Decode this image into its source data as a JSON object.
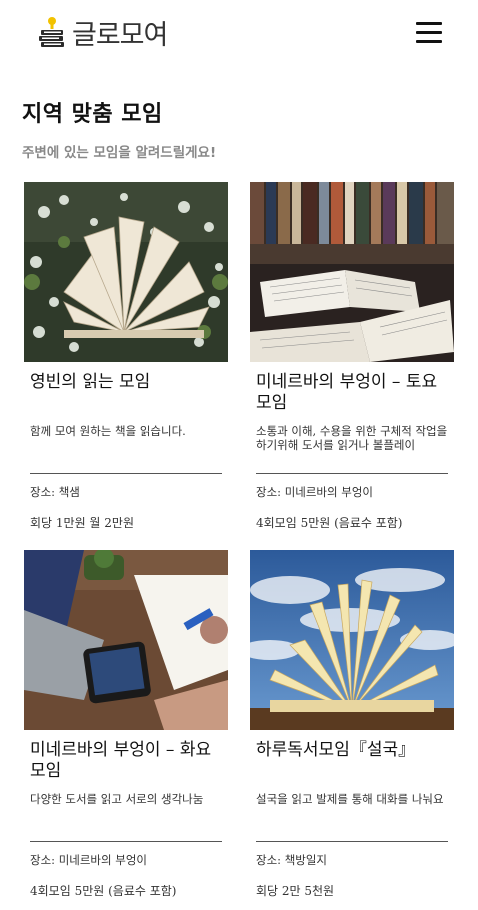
{
  "header": {
    "logo_text": "글로모여",
    "logo_icon": "books-with-lightbulb-icon",
    "menu_icon": "hamburger-menu-icon"
  },
  "page": {
    "title": "지역 맞춤 모임",
    "subtitle": "주변에 있는 모임을 알려드릴게요!"
  },
  "cards": [
    {
      "name": "영빈의 읽는 모임",
      "desc": "함께 모여 원하는 책을 읽습니다.",
      "place": "장소: 책샘",
      "fee": "회당 1만원 월 2만원"
    },
    {
      "name": "미네르바의 부엉이 – 토요모임",
      "desc": "소통과 이해, 수용을 위한 구체적 작업을 하기위해 도서를 읽거나 볼플레이",
      "place": "장소: 미네르바의 부엉이",
      "fee": "4회모임 5만원 (음료수 포함)"
    },
    {
      "name": "미네르바의 부엉이 – 화요모임",
      "desc": "다양한 도서를 읽고 서로의 생각나눔",
      "place": "장소: 미네르바의 부엉이",
      "fee": "4회모임 5만원 (음료수 포함)"
    },
    {
      "name": "하루독서모임『설국』",
      "desc": "설국을 읽고 발제를 통해 대화를 나눠요",
      "place": "장소: 책방일지",
      "fee": "회당 2만 5천원"
    }
  ]
}
